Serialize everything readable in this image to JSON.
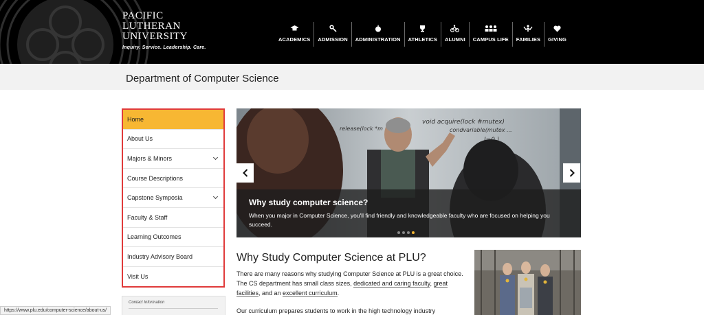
{
  "header": {
    "logo": {
      "line1": "PACIFIC",
      "line2": "LUTHERAN",
      "line3": "UNIVERSITY",
      "tagline": "Inquiry. Service. Leadership. Care."
    },
    "nav": [
      {
        "label": "ACADEMICS",
        "icon": "graduation-cap-icon"
      },
      {
        "label": "ADMISSION",
        "icon": "key-icon"
      },
      {
        "label": "ADMINISTRATION",
        "icon": "apple-icon"
      },
      {
        "label": "ATHLETICS",
        "icon": "trophy-icon"
      },
      {
        "label": "ALUMNI",
        "icon": "bike-icon"
      },
      {
        "label": "CAMPUS LIFE",
        "icon": "people-icon"
      },
      {
        "label": "FAMILIES",
        "icon": "family-icon"
      },
      {
        "label": "GIVING",
        "icon": "heart-icon"
      }
    ]
  },
  "page": {
    "title": "Department of Computer Science"
  },
  "sidebar": {
    "items": [
      {
        "label": "Home",
        "active": true
      },
      {
        "label": "About Us"
      },
      {
        "label": "Majors & Minors",
        "expandable": true
      },
      {
        "label": "Course Descriptions"
      },
      {
        "label": "Capstone Symposia",
        "expandable": true
      },
      {
        "label": "Faculty & Staff"
      },
      {
        "label": "Learning Outcomes"
      },
      {
        "label": "Industry Advisory Board"
      },
      {
        "label": "Visit Us"
      }
    ],
    "contact_label": "Contact Information"
  },
  "hero": {
    "title": "Why study computer science?",
    "text": "When you major in Computer Science, you'll find friendly and knowledgeable faculty who are focused on helping you succeed.",
    "board_text_1": "void acquire(lock #mutex)",
    "board_text_2": "release(lock *m",
    "board_text_3": "condvariable(mutex ...",
    "board_text_4": "I=0 )",
    "slide_count": 4,
    "active_slide": 4
  },
  "main": {
    "heading": "Why Study Computer Science at PLU?",
    "p1_a": "There are many reasons why studying Computer Science at PLU is a great choice. The CS department has small class sizes, ",
    "link1": "dedicated and caring faculty",
    "p1_b": ", ",
    "link2": "great facilities",
    "p1_c": ", and an ",
    "link3": "excellent curriculum",
    "p1_d": ".",
    "p2": "Our curriculum prepares students to work in the high technology industry"
  },
  "status_url": "https://www.plu.edu/computer-science/about-us/",
  "colors": {
    "accent": "#f7b733",
    "header_bg": "#000000",
    "highlight_border": "#e03a3a"
  }
}
